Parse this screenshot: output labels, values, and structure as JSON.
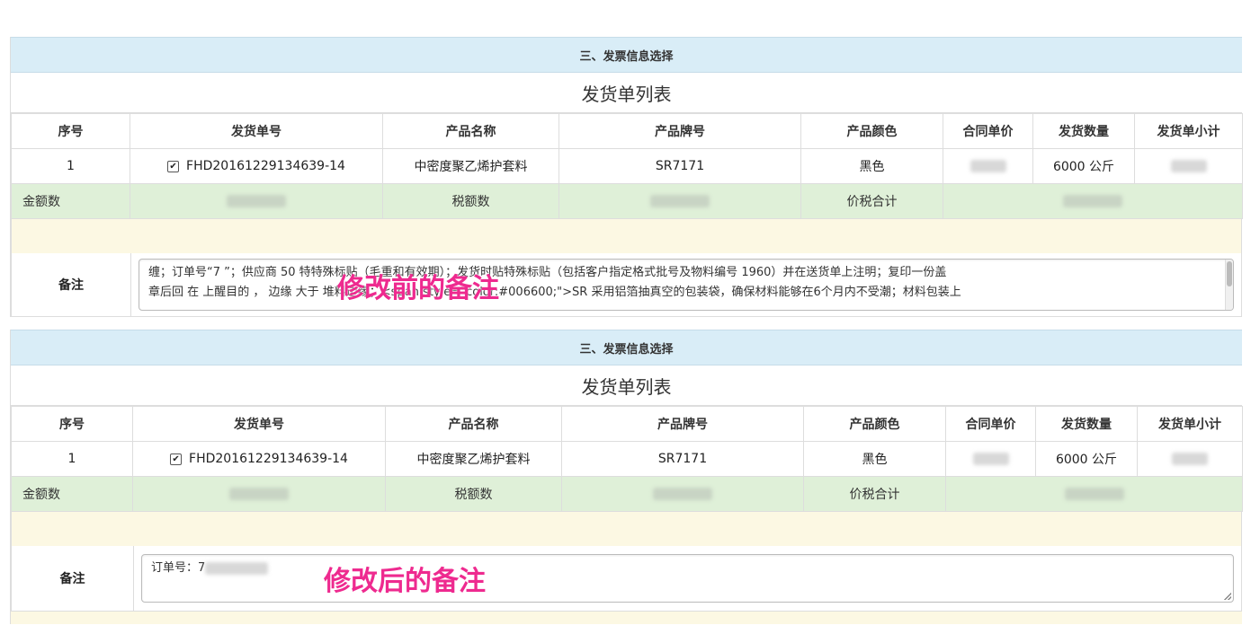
{
  "section_title": "三、发票信息选择",
  "list_title": "发货单列表",
  "columns": [
    "序号",
    "发货单号",
    "产品名称",
    "产品牌号",
    "产品颜色",
    "合同单价",
    "发货数量",
    "发货单小计"
  ],
  "row": {
    "index": "1",
    "checked_icon": "✔",
    "order_no": "FHD20161229134639-14",
    "product_name": "中密度聚乙烯护套料",
    "grade": "SR7171",
    "color": "黑色",
    "qty": "6000 公斤"
  },
  "summary": {
    "amount_label": "金额数",
    "tax_label": "税额数",
    "total_label": "价税合计"
  },
  "remark_label": "备注",
  "before": {
    "remark_text_line1": "缠；订单号“7            ”；供应商          50      特特殊标贴（毛重和有效期）；发货时贴特殊标贴（包括客户指定格式批号及物料编号          1960）并在送货单上注明；复印一份盖",
    "remark_text_line2": "章后回           在        上醒目的        ，    边缘    大于    堆料边缘；<span style=\"color:#006600;\">SR    采用铝箔抽真空的包装袋，确保材料能够在6个月内不受潮；材料包装上",
    "annotation": "修改前的备注"
  },
  "after": {
    "remark_text": "订单号：7",
    "annotation": "修改后的备注"
  }
}
